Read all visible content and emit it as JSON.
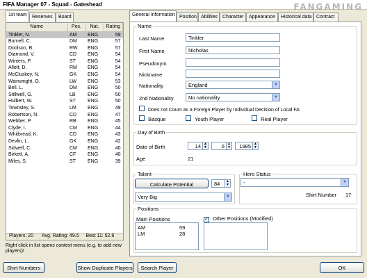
{
  "window": {
    "title": "FIFA Manager 07 - Squad - Gateshead",
    "watermark": "FANGAMING"
  },
  "left_tabs": [
    "1st team",
    "Reserves",
    "Board"
  ],
  "player_table": {
    "columns": [
      "Name",
      "Pos.",
      "Nat.",
      "Rating"
    ],
    "rows": [
      [
        "Tinkler, N.",
        "AM",
        "ENG",
        "59"
      ],
      [
        "Burnell, C.",
        "DM",
        "ENG",
        "57"
      ],
      [
        "Doolson, B.",
        "RW",
        "ENG",
        "57"
      ],
      [
        "Diamond, V.",
        "CD",
        "ENG",
        "54"
      ],
      [
        "Winters, P.",
        "ST",
        "ENG",
        "54"
      ],
      [
        "Allott, D.",
        "RM",
        "ENG",
        "54"
      ],
      [
        "McCluskey, N.",
        "GK",
        "ENG",
        "54"
      ],
      [
        "Wainwright, O.",
        "LW",
        "ENG",
        "53"
      ],
      [
        "Bell, L.",
        "DM",
        "ENG",
        "50"
      ],
      [
        "Stillwell, G.",
        "LB",
        "ENG",
        "50"
      ],
      [
        "Hulbert, W.",
        "ST",
        "ENG",
        "50"
      ],
      [
        "Townsley, S.",
        "LM",
        "ENG",
        "49"
      ],
      [
        "Robertson, N.",
        "CD",
        "ENG",
        "47"
      ],
      [
        "Webber, P.",
        "RB",
        "ENG",
        "45"
      ],
      [
        "Clyde, I.",
        "CM",
        "ENG",
        "44"
      ],
      [
        "Whitbread, K.",
        "CD",
        "ENG",
        "43"
      ],
      [
        "Devlin, L.",
        "GK",
        "ENG",
        "42"
      ],
      [
        "Sidwell, C.",
        "CM",
        "ENG",
        "40"
      ],
      [
        "Birkett, A.",
        "CF",
        "ENG",
        "40"
      ],
      [
        "Miles, S.",
        "ST",
        "ENG",
        "39"
      ]
    ],
    "footer": {
      "players": "Players: 20",
      "avg": "Avg. Rating: 49.5",
      "best": "Best 11: 52.8"
    }
  },
  "hint": "Right click in list opens context menu (e.g. to add new players)!",
  "bottom_buttons": {
    "shirt_numbers": "Shirt Numbers",
    "show_duplicates": "Show Duplicate Players",
    "search": "Search Player",
    "ok": "OK"
  },
  "right_tabs": [
    "General Information",
    "Position",
    "Abilities",
    "Character",
    "Appearance",
    "Historical data",
    "Contract"
  ],
  "name_group": {
    "title": "Name",
    "last_name_label": "Last Name",
    "last_name": "Tinkler",
    "first_name_label": "First Name",
    "first_name": "Nicholas",
    "pseudonym_label": "Pseudonym",
    "pseudonym": "",
    "nickname_label": "Nickname",
    "nickname": "",
    "nationality_label": "Nationality",
    "nationality": "England",
    "nationality2_label": "2nd Nationality",
    "nationality2": "No nationality",
    "foreign_check": "Does not Count as a Foreign Player by Individual Decision of Local FA",
    "basque": "Basque",
    "youth": "Youth Player",
    "real": "Real Player"
  },
  "dob_group": {
    "title": "Day of Birth",
    "label": "Date of Birth",
    "day": "14",
    "month": "6",
    "year": "1985",
    "age_label": "Age",
    "age": "21"
  },
  "talent_group": {
    "title": "Talent",
    "calc_button": "Calculate Potential",
    "value": "84",
    "level": "Very Big"
  },
  "hero_group": {
    "title": "Hero Status",
    "value": "-",
    "shirt_label": "Shirt Number",
    "shirt": "17"
  },
  "positions_group": {
    "title": "Positions",
    "main_label": "Main Positions",
    "main": [
      [
        "AM",
        "59"
      ],
      [
        "LM",
        "28"
      ]
    ],
    "other_label": "Other Positions (Modified)"
  }
}
